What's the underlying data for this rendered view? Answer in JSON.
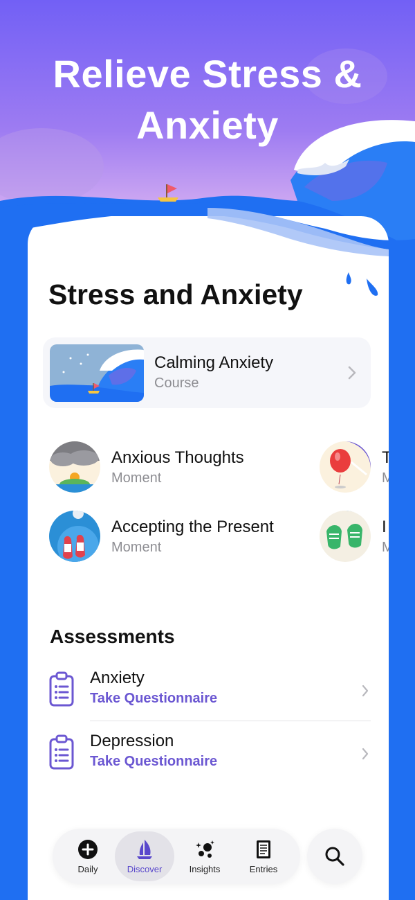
{
  "hero": {
    "title_line1": "Relieve Stress &",
    "title_line2": "Anxiety"
  },
  "colors": {
    "accent": "#6b57d2",
    "ocean": "#1f6ff2",
    "hero_top": "#7260f5"
  },
  "section": {
    "title": "Stress and Anxiety"
  },
  "course": {
    "title": "Calming Anxiety",
    "subtitle": "Course",
    "icon": "wave-boat-illustration"
  },
  "moments": [
    {
      "title": "Anxious Thoughts",
      "subtitle": "Moment",
      "icon": "storm-cloud-sun-illustration"
    },
    {
      "title": "T",
      "subtitle": "M",
      "icon": "balloon-pin-illustration"
    },
    {
      "title": "Accepting the Present",
      "subtitle": "Moment",
      "icon": "sneakers-top-view-illustration"
    },
    {
      "title": "I",
      "subtitle": "M",
      "icon": "green-sneakers-illustration"
    }
  ],
  "assessments": {
    "title": "Assessments",
    "items": [
      {
        "title": "Anxiety",
        "action": "Take Questionnaire",
        "icon": "clipboard-icon"
      },
      {
        "title": "Depression",
        "action": "Take Questionnaire",
        "icon": "clipboard-icon"
      }
    ]
  },
  "tabbar": {
    "tabs": [
      {
        "label": "Daily",
        "icon": "plus-circle-icon"
      },
      {
        "label": "Discover",
        "icon": "sailboat-icon",
        "active": true
      },
      {
        "label": "Insights",
        "icon": "sparkle-dots-icon"
      },
      {
        "label": "Entries",
        "icon": "journal-icon"
      }
    ],
    "search_icon": "search-icon"
  }
}
